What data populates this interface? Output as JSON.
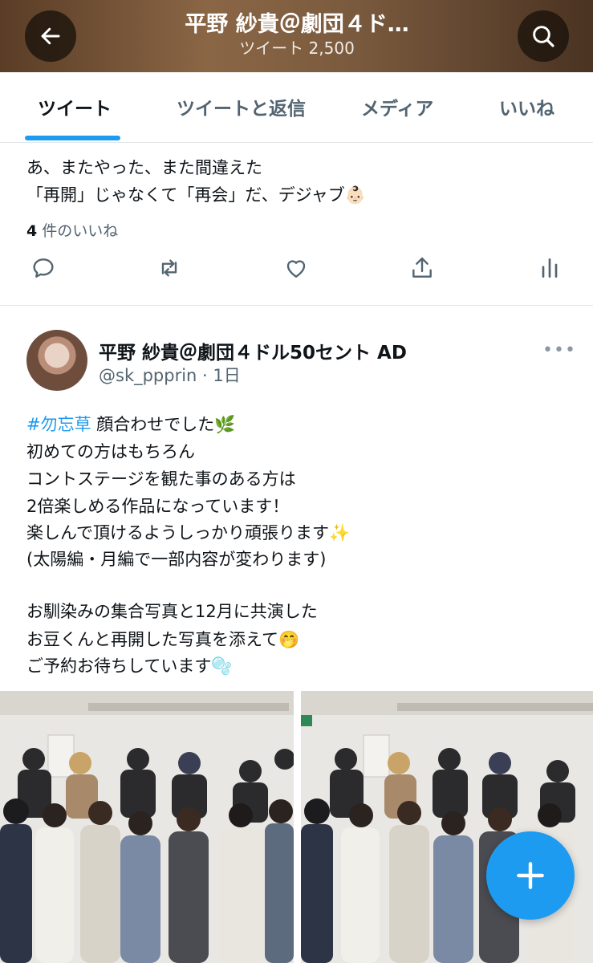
{
  "header": {
    "title": "平野 紗貴＠劇団４ド…",
    "subtitle": "ツイート 2,500",
    "back_icon": "arrow-left-icon",
    "search_icon": "search-icon"
  },
  "tabs": [
    {
      "label": "ツイート",
      "active": true
    },
    {
      "label": "ツイートと返信",
      "active": false
    },
    {
      "label": "メディア",
      "active": false
    },
    {
      "label": "いいね",
      "active": false
    }
  ],
  "tweet1": {
    "lines": [
      "あ、またやった、また間違えた",
      "「再開」じゃなくて「再会」だ、デジャブ👶🏻"
    ],
    "likes_count": "4",
    "likes_label": "件のいいね",
    "actions": [
      "reply-icon",
      "retweet-icon",
      "like-icon",
      "share-icon",
      "analytics-icon"
    ]
  },
  "tweet2": {
    "name": "平野 紗貴＠劇団４ドル50セント AD",
    "handle": "@sk_ppprin · 1日",
    "hashtag": "#勿忘草",
    "first_line_rest": " 顔合わせでした🌿",
    "lines": [
      "初めての方はもちろん",
      "コントステージを観た事のある方は",
      "2倍楽しめる作品になっています！",
      "楽しんで頂けるようしっかり頑張ります✨",
      "(太陽編・月編で一部内容が変わります)",
      "",
      "お馴染みの集合写真と12月に共演した",
      "お豆くんと再開した写真を添えて🤭",
      "ご予約お待ちしています🫧"
    ],
    "more_label": "•••"
  },
  "fab": {
    "icon": "plus-icon"
  },
  "colors": {
    "accent": "#1d9bf0",
    "text": "#0f1419",
    "secondary": "#536471"
  }
}
